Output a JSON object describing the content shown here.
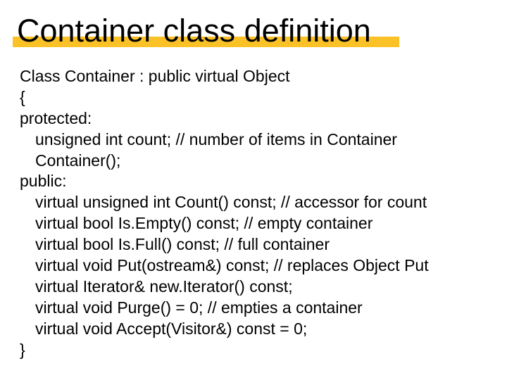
{
  "title": "Container class definition",
  "lines": {
    "l0": "Class Container : public virtual Object",
    "l1": "{",
    "l2": "protected:",
    "l3": "unsigned int count;  // number of items in Container",
    "l4": "Container();",
    "l5": "public:",
    "l6": "virtual unsigned int Count() const; // accessor for count",
    "l7": "virtual bool Is.Empty() const;  // empty container",
    "l8": "virtual bool Is.Full() const;  // full container",
    "l9": "virtual void Put(ostream&) const; // replaces Object Put",
    "l10": "virtual Iterator& new.Iterator() const;",
    "l11": "virtual void Purge() = 0; // empties a container",
    "l12": "virtual void Accept(Visitor&) const = 0;",
    "l13": "}"
  }
}
